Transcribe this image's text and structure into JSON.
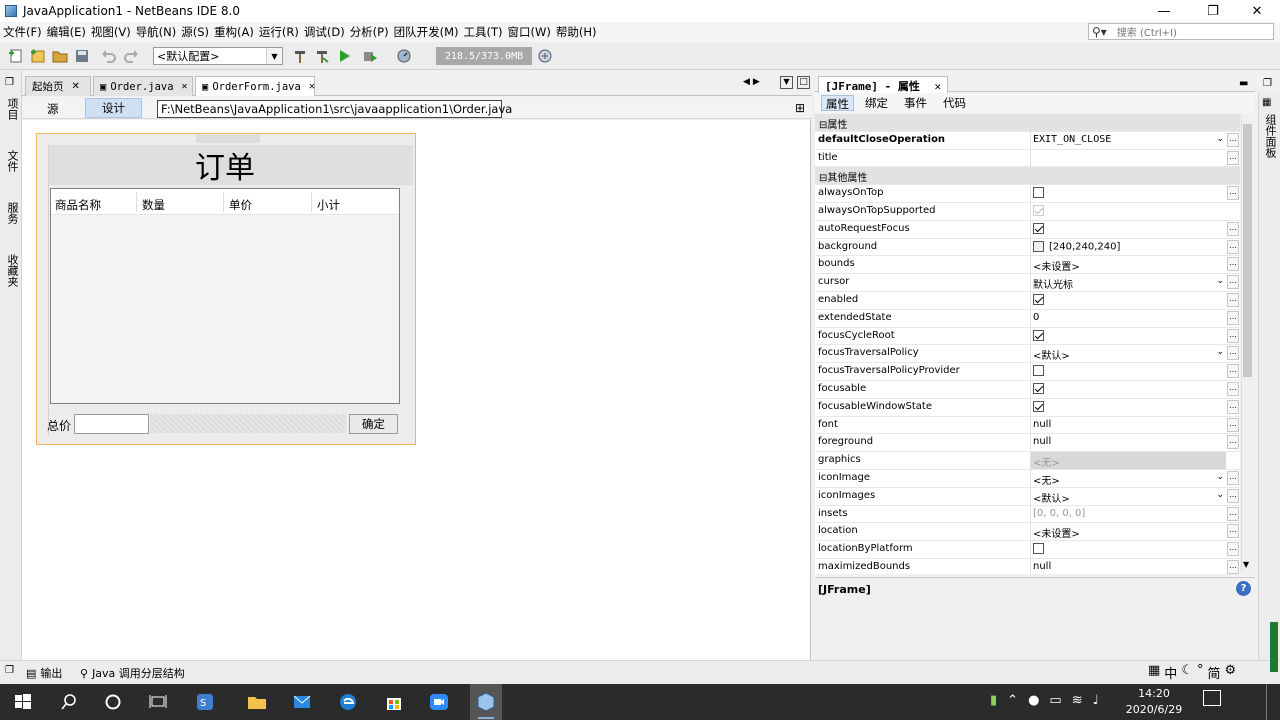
{
  "window": {
    "title": "JavaApplication1 - NetBeans IDE 8.0"
  },
  "menu": [
    "文件(F)",
    "编辑(E)",
    "视图(V)",
    "导航(N)",
    "源(S)",
    "重构(A)",
    "运行(R)",
    "调试(D)",
    "分析(P)",
    "团队开发(M)",
    "工具(T)",
    "窗口(W)",
    "帮助(H)"
  ],
  "search": {
    "placeholder": "搜索 (Ctrl+I)"
  },
  "toolbar": {
    "config": "<默认配置>",
    "memory": "218.5/373.0MB"
  },
  "left_panels": [
    "项目",
    "文件",
    "服务",
    "收藏夹"
  ],
  "editor": {
    "tabs": [
      "起始页",
      "Order.java",
      "OrderForm.java"
    ],
    "subtabs": [
      "源",
      "设计"
    ],
    "tooltip": "F:\\NetBeans\\JavaApplication1\\src\\javaapplication1\\Order.java"
  },
  "form": {
    "title": "订单",
    "columns": [
      "商品名称",
      "数量",
      "单价",
      "小计"
    ],
    "total_label": "总价",
    "confirm_label": "确定"
  },
  "properties": {
    "header": "[JFrame] - 属性",
    "tabs": [
      "属性",
      "绑定",
      "事件",
      "代码"
    ],
    "rows": [
      {
        "cat": true,
        "name": "属性"
      },
      {
        "name": "defaultCloseOperation",
        "value": "EXIT_ON_CLOSE",
        "kind": "dropdown",
        "bold": true
      },
      {
        "name": "title",
        "value": "",
        "kind": "text"
      },
      {
        "cat": true,
        "name": "其他属性"
      },
      {
        "name": "alwaysOnTop",
        "value": "",
        "kind": "check-off"
      },
      {
        "name": "alwaysOnTopSupported",
        "value": "",
        "kind": "check-disabled"
      },
      {
        "name": "autoRequestFocus",
        "value": "",
        "kind": "check-on"
      },
      {
        "name": "background",
        "value": "[240,240,240]",
        "kind": "color"
      },
      {
        "name": "bounds",
        "value": "<未设置>",
        "kind": "text"
      },
      {
        "name": "cursor",
        "value": "默认光标",
        "kind": "dropdown"
      },
      {
        "name": "enabled",
        "value": "",
        "kind": "check-on"
      },
      {
        "name": "extendedState",
        "value": "0",
        "kind": "text"
      },
      {
        "name": "focusCycleRoot",
        "value": "",
        "kind": "check-on"
      },
      {
        "name": "focusTraversalPolicy",
        "value": "<默认>",
        "kind": "dropdown"
      },
      {
        "name": "focusTraversalPolicyProvider",
        "value": "",
        "kind": "check-off"
      },
      {
        "name": "focusable",
        "value": "",
        "kind": "check-on"
      },
      {
        "name": "focusableWindowState",
        "value": "",
        "kind": "check-on"
      },
      {
        "name": "font",
        "value": "null",
        "kind": "text"
      },
      {
        "name": "foreground",
        "value": "null",
        "kind": "text"
      },
      {
        "name": "graphics",
        "value": "<无>",
        "kind": "readonly"
      },
      {
        "name": "iconImage",
        "value": "<无>",
        "kind": "dropdown"
      },
      {
        "name": "iconImages",
        "value": "<默认>",
        "kind": "dropdown"
      },
      {
        "name": "insets",
        "value": "[0, 0, 0, 0]",
        "kind": "grey"
      },
      {
        "name": "location",
        "value": "<未设置>",
        "kind": "text"
      },
      {
        "name": "locationByPlatform",
        "value": "",
        "kind": "check-off"
      },
      {
        "name": "maximizedBounds",
        "value": "null",
        "kind": "text"
      }
    ],
    "description": "[JFrame]"
  },
  "right_panels": [
    "组件面板"
  ],
  "status": {
    "output": "输出",
    "hierarchy": "Java 调用分层结构"
  },
  "ime": [
    "中",
    "简"
  ],
  "clock": {
    "time": "14:20",
    "date": "2020/6/29"
  },
  "colors": {
    "taskbar": "#2b2b2b",
    "frame_border": "#f2b55f",
    "accent": "#3a6fc4"
  }
}
